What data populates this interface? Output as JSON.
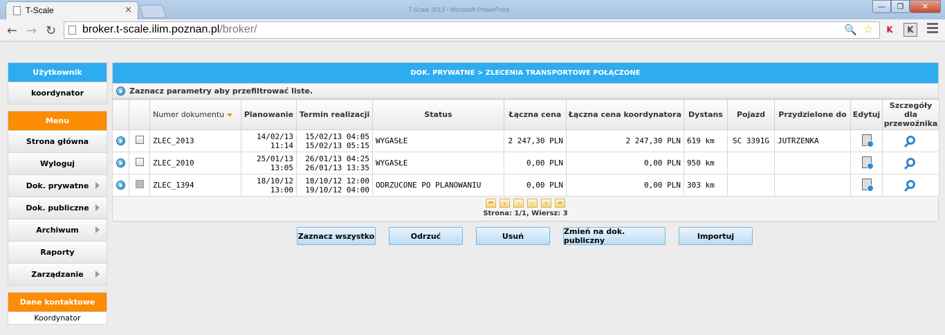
{
  "browser": {
    "tab_title": "T-Scale",
    "tab_close": "×",
    "window_title": "T-Scale 2013 - Microsoft PowerPoint",
    "url_host": "broker.t-scale.ilim.poznan.pl",
    "url_path": "/broker/",
    "back": "←",
    "forward": "→",
    "reload": "↻",
    "min": "—",
    "max": "❐",
    "close": "✕",
    "zoom": "🔍",
    "star": "☆",
    "ext1": "K",
    "ext2": "K"
  },
  "sidebar": {
    "user_header": "Użytkownik",
    "user_name": "koordynator",
    "menu_header": "Menu",
    "items": [
      {
        "label": "Strona główna",
        "submenu": false
      },
      {
        "label": "Wyloguj",
        "submenu": false
      },
      {
        "label": "Dok. prywatne",
        "submenu": true
      },
      {
        "label": "Dok. publiczne",
        "submenu": true
      },
      {
        "label": "Archiwum",
        "submenu": true
      },
      {
        "label": "Raporty",
        "submenu": false
      },
      {
        "label": "Zarządzanie",
        "submenu": true
      }
    ],
    "contact_header": "Dane kontaktowe",
    "contact_value": "Koordynator"
  },
  "main": {
    "title": "DOK. PRYWATNE > ZLECENIA TRANSPORTOWE POŁĄCZONE",
    "filter_hint": "Zaznacz parametry aby przefiltrować liste.",
    "columns": [
      "Numer dokumentu",
      "Planowanie",
      "Termin realizacji",
      "Status",
      "Łączna cena",
      "Łączna cena koordynatora",
      "Dystans",
      "Pojazd",
      "Przydzielone do",
      "Edytuj",
      "Szczegóły dla przewoźnika"
    ],
    "rows": [
      {
        "number": "ZLEC_2013",
        "plan_date": "14/02/13",
        "plan_time": "11:14",
        "term_start": "15/02/13 04:05",
        "term_end": "15/02/13 05:15",
        "status": "WYGASŁE",
        "price": "2 247,30 PLN",
        "coord_price": "2 247,30 PLN",
        "distance": "619 km",
        "vehicle": "SC 3391G",
        "assigned": "JUTRZENKA",
        "checkbox_disabled": false
      },
      {
        "number": "ZLEC_2010",
        "plan_date": "25/01/13",
        "plan_time": "13:05",
        "term_start": "26/01/13 04:25",
        "term_end": "26/01/13 13:35",
        "status": "WYGASŁE",
        "price": "0,00 PLN",
        "coord_price": "0,00 PLN",
        "distance": "950 km",
        "vehicle": "",
        "assigned": "",
        "checkbox_disabled": false
      },
      {
        "number": "ZLEC_1394",
        "plan_date": "18/10/12",
        "plan_time": "13:00",
        "term_start": "18/10/12 12:00",
        "term_end": "19/10/12 04:00",
        "status": "ODRZUCONE PO PLANOWANIU",
        "price": "0,00 PLN",
        "coord_price": "0,00 PLN",
        "distance": "303 km",
        "vehicle": "",
        "assigned": "",
        "checkbox_disabled": true
      }
    ],
    "pager": {
      "buttons": [
        "⏮",
        "«",
        "‹",
        "›",
        "»",
        "⏭"
      ],
      "info": "Strona: 1/1, Wiersz: 3"
    },
    "actions": [
      "Zaznacz wszystko",
      "Odrzuć",
      "Usuń",
      "Zmień na dok. publiczny",
      "Importuj"
    ]
  },
  "colors": {
    "header_blue": "#2eacf0",
    "menu_orange": "#fb8c03"
  }
}
